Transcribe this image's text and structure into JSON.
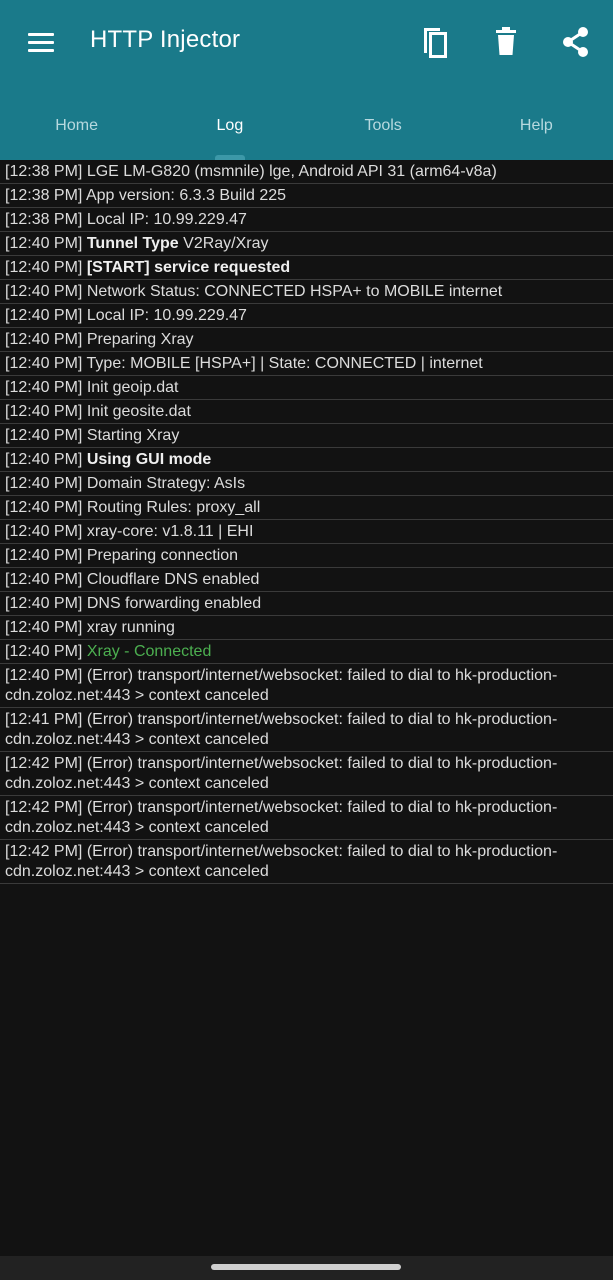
{
  "app": {
    "title": "HTTP Injector",
    "icons": [
      "menu-icon",
      "copy-icon",
      "delete-icon",
      "share-icon"
    ]
  },
  "tabs": [
    {
      "label": "Home"
    },
    {
      "label": "Log"
    },
    {
      "label": "Tools"
    },
    {
      "label": "Help"
    }
  ],
  "active_tab": "Log",
  "colors": {
    "appbar": "#1a7a8a",
    "background": "#121212",
    "connected": "#4caf50"
  },
  "log": [
    {
      "time": "[12:38 PM]",
      "bold": "",
      "text": "LGE LM-G820 (msmnile) lge, Android API 31 (arm64-v8a)"
    },
    {
      "time": "[12:38 PM]",
      "bold": "",
      "text": "App version: 6.3.3 Build 225"
    },
    {
      "time": "[12:38 PM]",
      "bold": "",
      "text": "Local IP: 10.99.229.47"
    },
    {
      "time": "[12:40 PM]",
      "bold": "Tunnel Type",
      "text": "V2Ray/Xray"
    },
    {
      "time": "[12:40 PM]",
      "bold": "[START] service requested",
      "text": ""
    },
    {
      "time": "[12:40 PM]",
      "bold": "",
      "text": "Network Status: CONNECTED HSPA+ to MOBILE internet"
    },
    {
      "time": "[12:40 PM]",
      "bold": "",
      "text": "Local IP: 10.99.229.47"
    },
    {
      "time": "[12:40 PM]",
      "bold": "",
      "text": "Preparing Xray"
    },
    {
      "time": "[12:40 PM]",
      "bold": "",
      "text": "Type: MOBILE [HSPA+] | State: CONNECTED | internet"
    },
    {
      "time": "[12:40 PM]",
      "bold": "",
      "text": "Init geoip.dat"
    },
    {
      "time": "[12:40 PM]",
      "bold": "",
      "text": "Init geosite.dat"
    },
    {
      "time": "[12:40 PM]",
      "bold": "",
      "text": "Starting Xray"
    },
    {
      "time": "[12:40 PM]",
      "bold": "Using GUI mode",
      "text": ""
    },
    {
      "time": "[12:40 PM]",
      "bold": "",
      "text": "Domain Strategy: AsIs"
    },
    {
      "time": "[12:40 PM]",
      "bold": "",
      "text": "Routing Rules: proxy_all"
    },
    {
      "time": "[12:40 PM]",
      "bold": "",
      "text": "xray-core: v1.8.11 | EHI"
    },
    {
      "time": "[12:40 PM]",
      "bold": "",
      "text": "Preparing connection"
    },
    {
      "time": "[12:40 PM]",
      "bold": "",
      "text": "Cloudflare DNS enabled"
    },
    {
      "time": "[12:40 PM]",
      "bold": "",
      "text": "DNS forwarding enabled"
    },
    {
      "time": "[12:40 PM]",
      "bold": "",
      "text": "xray running"
    },
    {
      "time": "[12:40 PM]",
      "bold": "",
      "text": "",
      "green": "Xray - Connected"
    },
    {
      "time": "[12:40 PM]",
      "bold": "",
      "text": "(Error) transport/internet/websocket: failed to dial to hk-production-cdn.zoloz.net:443 > context canceled"
    },
    {
      "time": "[12:41 PM]",
      "bold": "",
      "text": "(Error) transport/internet/websocket: failed to dial to hk-production-cdn.zoloz.net:443 > context canceled"
    },
    {
      "time": "[12:42 PM]",
      "bold": "",
      "text": "(Error) transport/internet/websocket: failed to dial to hk-production-cdn.zoloz.net:443 > context canceled"
    },
    {
      "time": "[12:42 PM]",
      "bold": "",
      "text": "(Error) transport/internet/websocket: failed to dial to hk-production-cdn.zoloz.net:443 > context canceled"
    },
    {
      "time": "[12:42 PM]",
      "bold": "",
      "text": "(Error) transport/internet/websocket: failed to dial to hk-production-cdn.zoloz.net:443 > context canceled"
    }
  ]
}
